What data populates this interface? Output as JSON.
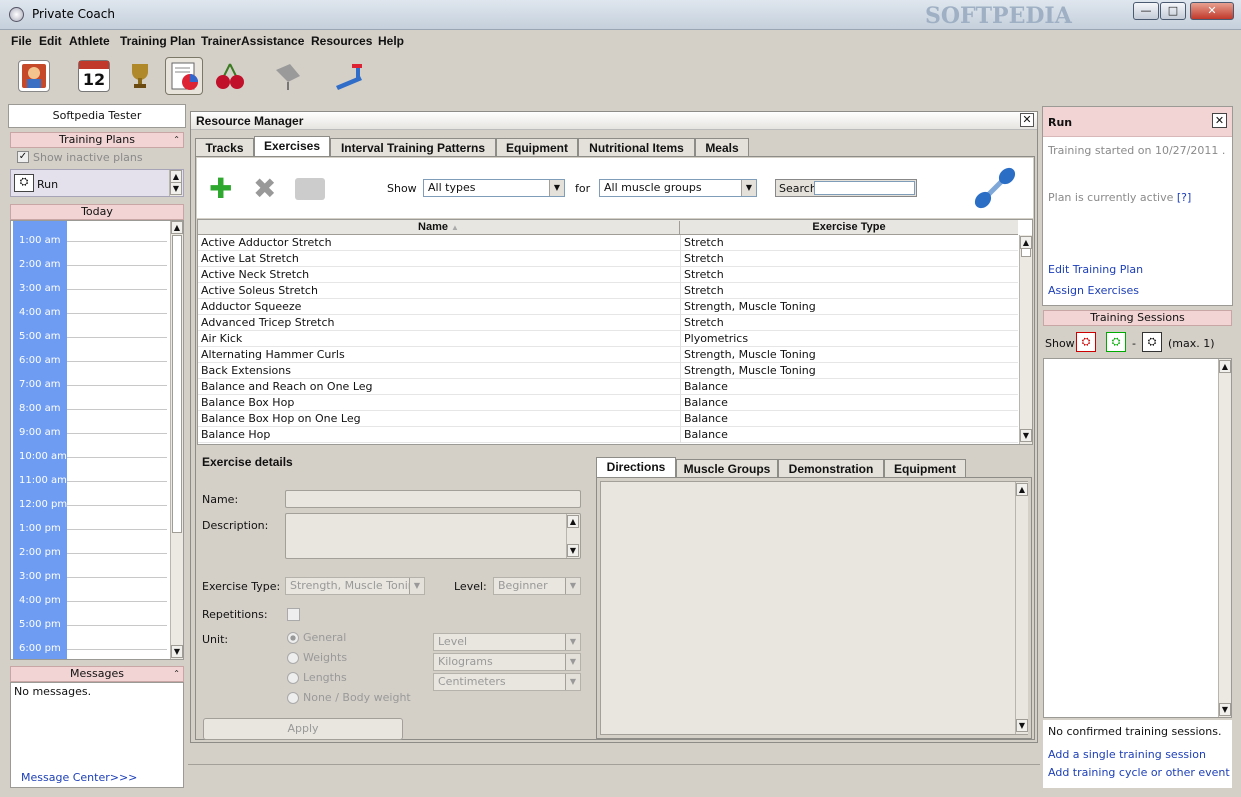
{
  "window": {
    "title": "Private Coach",
    "watermark": "SOFTPEDIA"
  },
  "menu": [
    "File",
    "Edit",
    "Athlete",
    "Training Plan",
    "TrainerAssistance",
    "Resources",
    "Help"
  ],
  "toolbar_icons": [
    "athlete-icon",
    "calendar-icon",
    "trophy-icon",
    "report-icon",
    "nutrition-icon",
    "equipment-icon",
    "treadmill-icon"
  ],
  "calendar_day": "12",
  "left": {
    "athlete": "Softpedia Tester",
    "training_plans_header": "Training Plans",
    "show_inactive": "Show inactive plans",
    "plan": "Run",
    "today_header": "Today",
    "times": [
      "1:00 am",
      "2:00 am",
      "3:00 am",
      "4:00 am",
      "5:00 am",
      "6:00 am",
      "7:00 am",
      "8:00 am",
      "9:00 am",
      "10:00 am",
      "11:00 am",
      "12:00 pm",
      "1:00 pm",
      "2:00 pm",
      "3:00 pm",
      "4:00 pm",
      "5:00 pm",
      "6:00 pm"
    ],
    "messages_header": "Messages",
    "messages_text": "No messages.",
    "message_center": "Message Center>>>"
  },
  "rm": {
    "title": "Resource Manager",
    "tabs": [
      "Tracks",
      "Exercises",
      "Interval Training Patterns",
      "Equipment",
      "Nutritional Items",
      "Meals"
    ],
    "show_label": "Show",
    "show_value": "All types",
    "for_label": "for",
    "for_value": "All muscle groups",
    "search_label": "Search",
    "search_value": "",
    "col_name": "Name",
    "col_type": "Exercise Type",
    "rows": [
      [
        "Active Adductor Stretch",
        "Stretch"
      ],
      [
        "Active Lat Stretch",
        "Stretch"
      ],
      [
        "Active Neck Stretch",
        "Stretch"
      ],
      [
        "Active Soleus Stretch",
        "Stretch"
      ],
      [
        "Adductor Squeeze",
        "Strength, Muscle Toning"
      ],
      [
        "Advanced Tricep Stretch",
        "Stretch"
      ],
      [
        "Air Kick",
        "Plyometrics"
      ],
      [
        "Alternating Hammer Curls",
        "Strength, Muscle Toning"
      ],
      [
        "Back Extensions",
        "Strength, Muscle Toning"
      ],
      [
        "Balance and Reach on One Leg",
        "Balance"
      ],
      [
        "Balance Box Hop",
        "Balance"
      ],
      [
        "Balance Box Hop on One Leg",
        "Balance"
      ],
      [
        "Balance Hop",
        "Balance"
      ]
    ],
    "details": {
      "title": "Exercise details",
      "name_label": "Name:",
      "description_label": "Description:",
      "exercise_type_label": "Exercise Type:",
      "exercise_type_value": "Strength, Muscle Toning",
      "level_label": "Level:",
      "level_value": "Beginner",
      "repetitions_label": "Repetitions:",
      "unit_label": "Unit:",
      "units": [
        "General",
        "Weights",
        "Lengths",
        "None / Body weight"
      ],
      "unit_values": [
        "Level",
        "Kilograms",
        "Centimeters"
      ],
      "apply": "Apply"
    },
    "detail_tabs": [
      "Directions",
      "Muscle Groups",
      "Demonstration",
      "Equipment"
    ]
  },
  "right": {
    "plan_title": "Run",
    "started": "Training started on 10/27/2011 .",
    "active": "Plan is currently active",
    "help_link": "[?]",
    "edit_plan": "Edit Training Plan",
    "assign": "Assign Exercises",
    "sessions_header": "Training Sessions",
    "show_label": "Show",
    "dash": "-",
    "max": "(max. 1)",
    "no_sessions": "No confirmed training sessions.",
    "add_single": "Add a single training session",
    "add_cycle": "Add training cycle or other event"
  }
}
